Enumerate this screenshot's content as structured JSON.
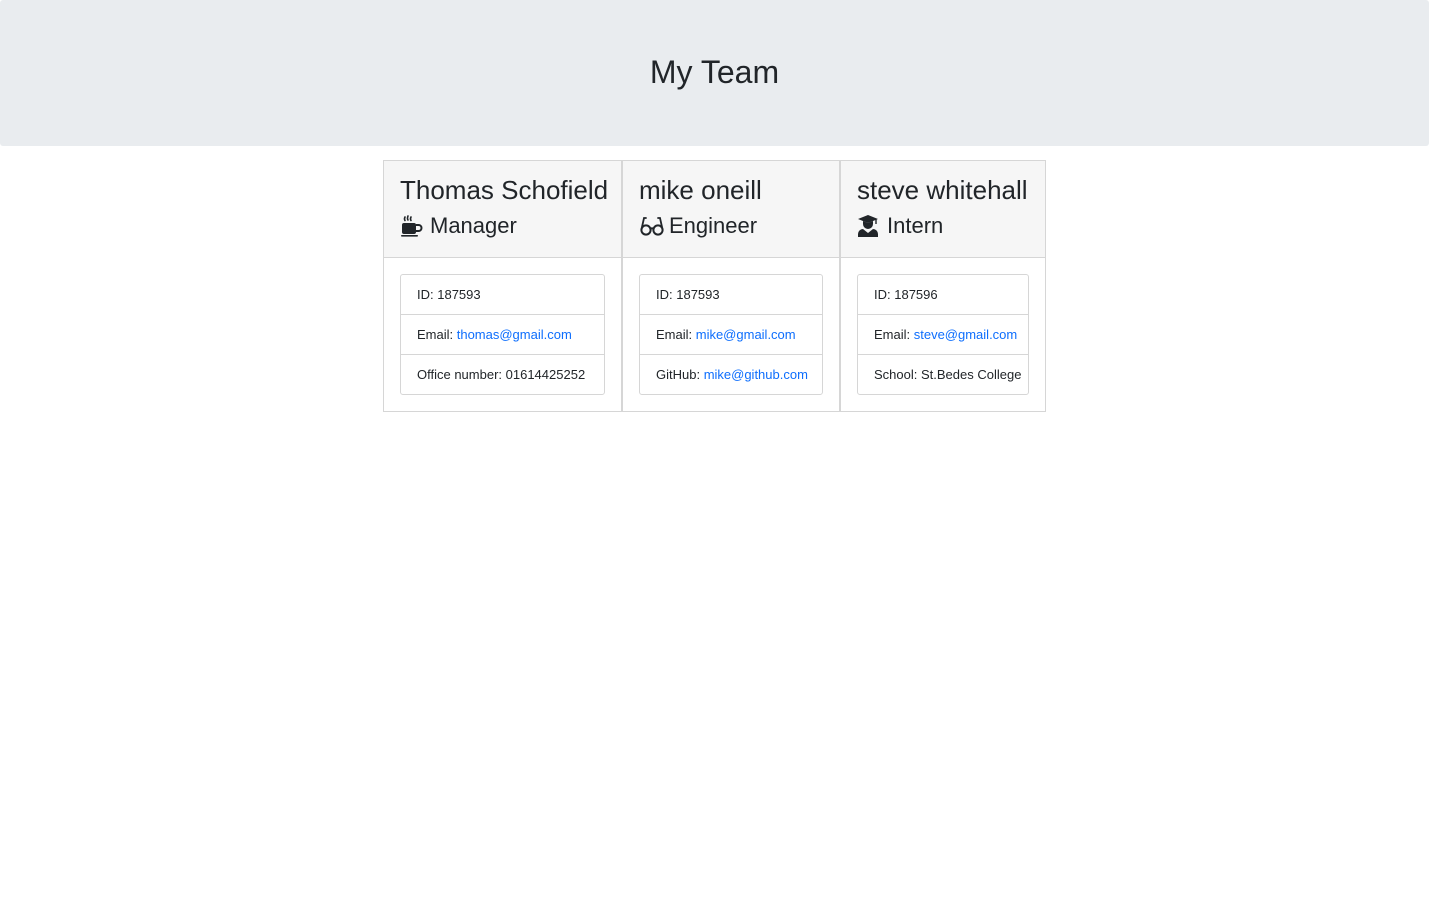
{
  "header": {
    "title": "My Team"
  },
  "cards": [
    {
      "name": "Thomas Schofield",
      "role": "Manager",
      "icon": "mug-icon",
      "id_label": "ID: ",
      "id": "187593",
      "email_label": "Email: ",
      "email": "thomas@gmail.com",
      "extra_label": "Office number: ",
      "extra": "01614425252"
    },
    {
      "name": "mike oneill",
      "role": "Engineer",
      "icon": "glasses-icon",
      "id_label": "ID: ",
      "id": "187593",
      "email_label": "Email: ",
      "email": "mike@gmail.com",
      "extra_label": "GitHub: ",
      "extra": "mike@github.com"
    },
    {
      "name": "steve whitehall",
      "role": "Intern",
      "icon": "graduate-icon",
      "id_label": "ID: ",
      "id": "187596",
      "email_label": "Email: ",
      "email": "steve@gmail.com",
      "extra_label": "School: ",
      "extra": "St.Bedes College"
    }
  ],
  "colors": {
    "jumbotron": "#e9ecef",
    "link": "#0d6efd",
    "text": "#212529"
  }
}
